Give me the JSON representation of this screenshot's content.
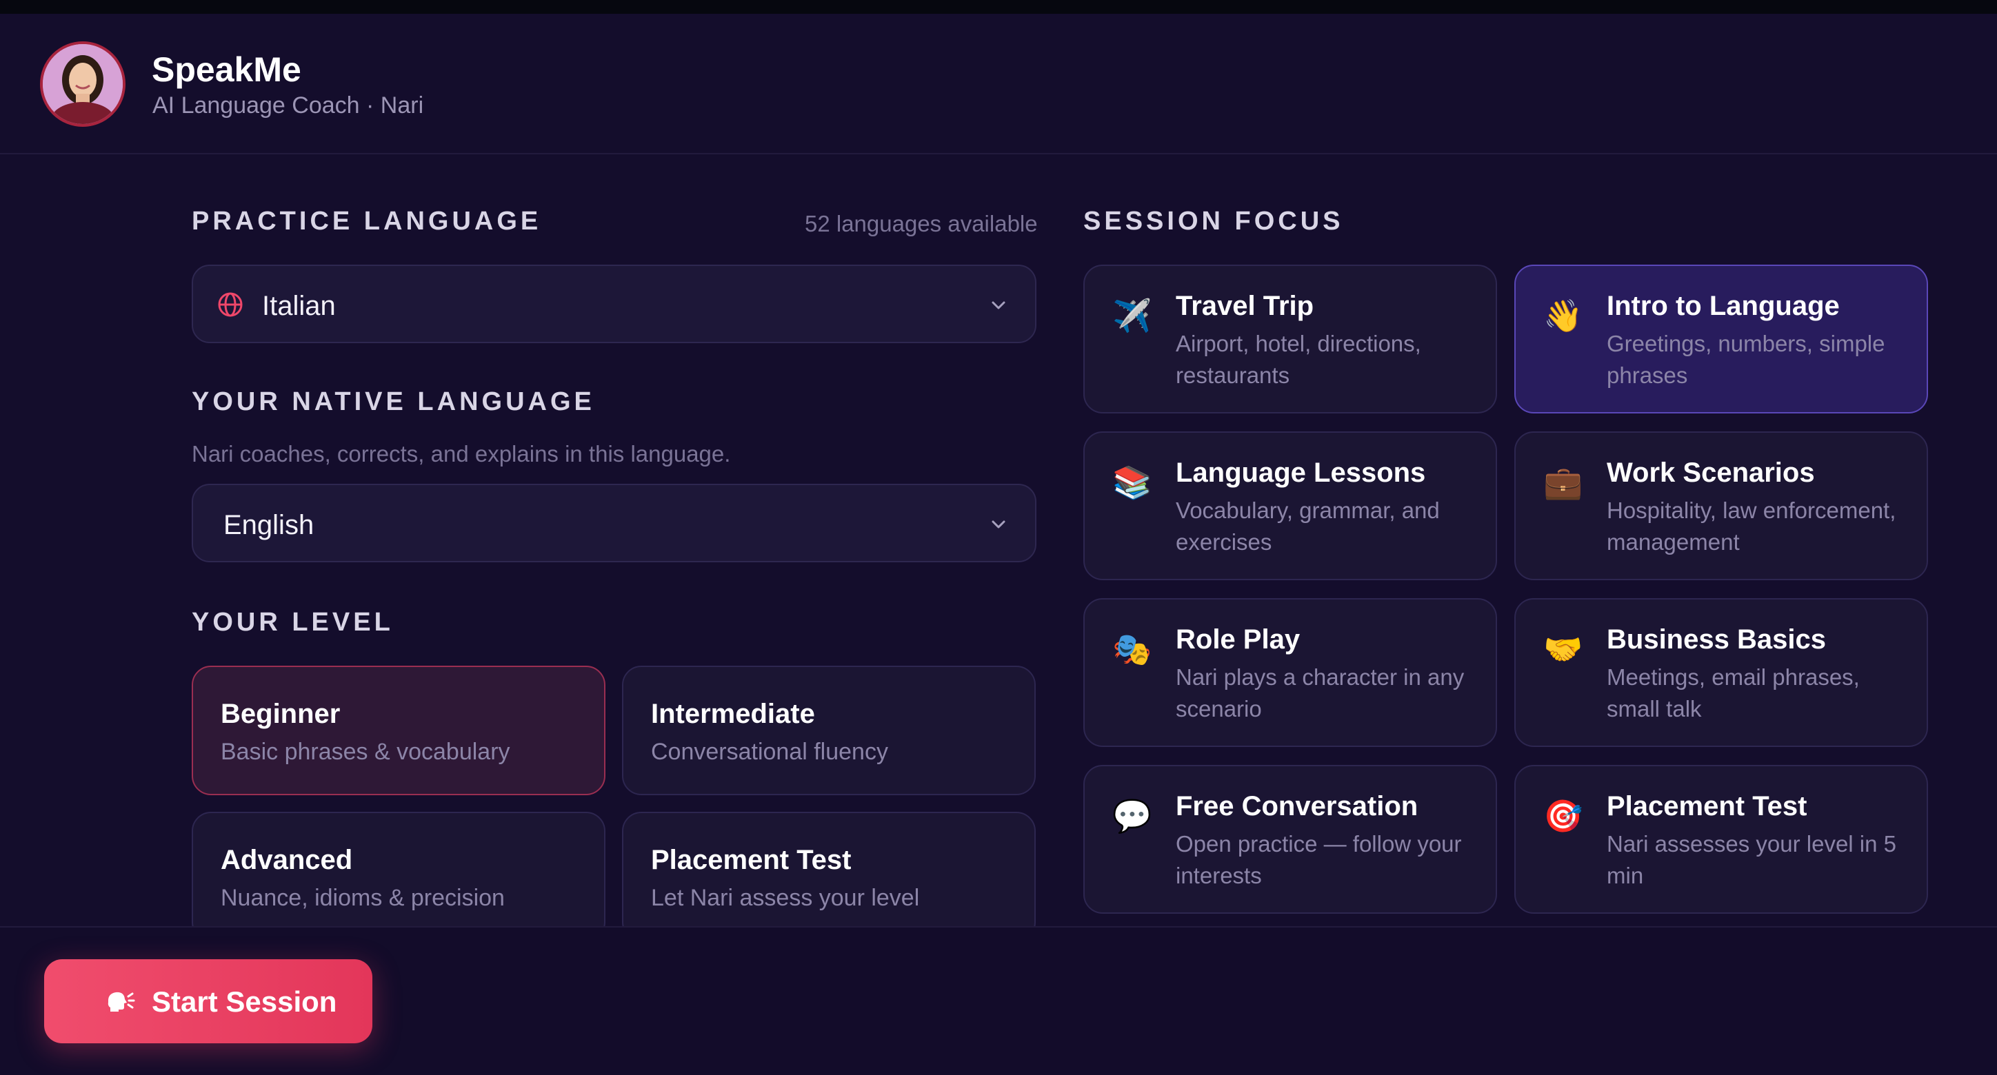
{
  "header": {
    "app_name": "SpeakMe",
    "subtitle": "AI Language Coach · Nari"
  },
  "practice": {
    "label": "PRACTICE LANGUAGE",
    "count": "52 languages available",
    "selected": "Italian",
    "icon": "globe-icon"
  },
  "native": {
    "label": "YOUR NATIVE LANGUAGE",
    "hint": "Nari coaches, corrects, and explains in this language.",
    "selected": "English"
  },
  "level": {
    "label": "YOUR LEVEL",
    "options": [
      {
        "title": "Beginner",
        "desc": "Basic phrases & vocabulary",
        "selected": true
      },
      {
        "title": "Intermediate",
        "desc": "Conversational fluency",
        "selected": false
      },
      {
        "title": "Advanced",
        "desc": "Nuance, idioms & precision",
        "selected": false
      },
      {
        "title": "Placement Test",
        "desc": "Let Nari assess your level",
        "selected": false
      }
    ]
  },
  "focus": {
    "label": "SESSION FOCUS",
    "options": [
      {
        "icon": "✈️",
        "icon_name": "airplane-icon",
        "title": "Travel Trip",
        "desc": "Airport, hotel, directions, restaurants",
        "selected": false
      },
      {
        "icon": "👋",
        "icon_name": "waving-hand-icon",
        "title": "Intro to Language",
        "desc": "Greetings, numbers, simple phrases",
        "selected": true
      },
      {
        "icon": "📚",
        "icon_name": "books-icon",
        "title": "Language Lessons",
        "desc": "Vocabulary, grammar, and exercises",
        "selected": false
      },
      {
        "icon": "💼",
        "icon_name": "briefcase-icon",
        "title": "Work Scenarios",
        "desc": "Hospitality, law enforcement, management",
        "selected": false
      },
      {
        "icon": "🎭",
        "icon_name": "theater-masks-icon",
        "title": "Role Play",
        "desc": "Nari plays a character in any scenario",
        "selected": false
      },
      {
        "icon": "🤝",
        "icon_name": "handshake-icon",
        "title": "Business Basics",
        "desc": "Meetings, email phrases, small talk",
        "selected": false
      },
      {
        "icon": "💬",
        "icon_name": "speech-bubble-icon",
        "title": "Free Conversation",
        "desc": "Open practice — follow your interests",
        "selected": false
      },
      {
        "icon": "🎯",
        "icon_name": "target-icon",
        "title": "Placement Test",
        "desc": "Nari assesses your level in 5 min",
        "selected": false
      }
    ]
  },
  "cta": {
    "label": "Start Session",
    "icon": "speaking-head-icon"
  },
  "colors": {
    "background": "#140d2c",
    "accent": "#e83a5f",
    "selected_violet": "#5a47b8"
  }
}
